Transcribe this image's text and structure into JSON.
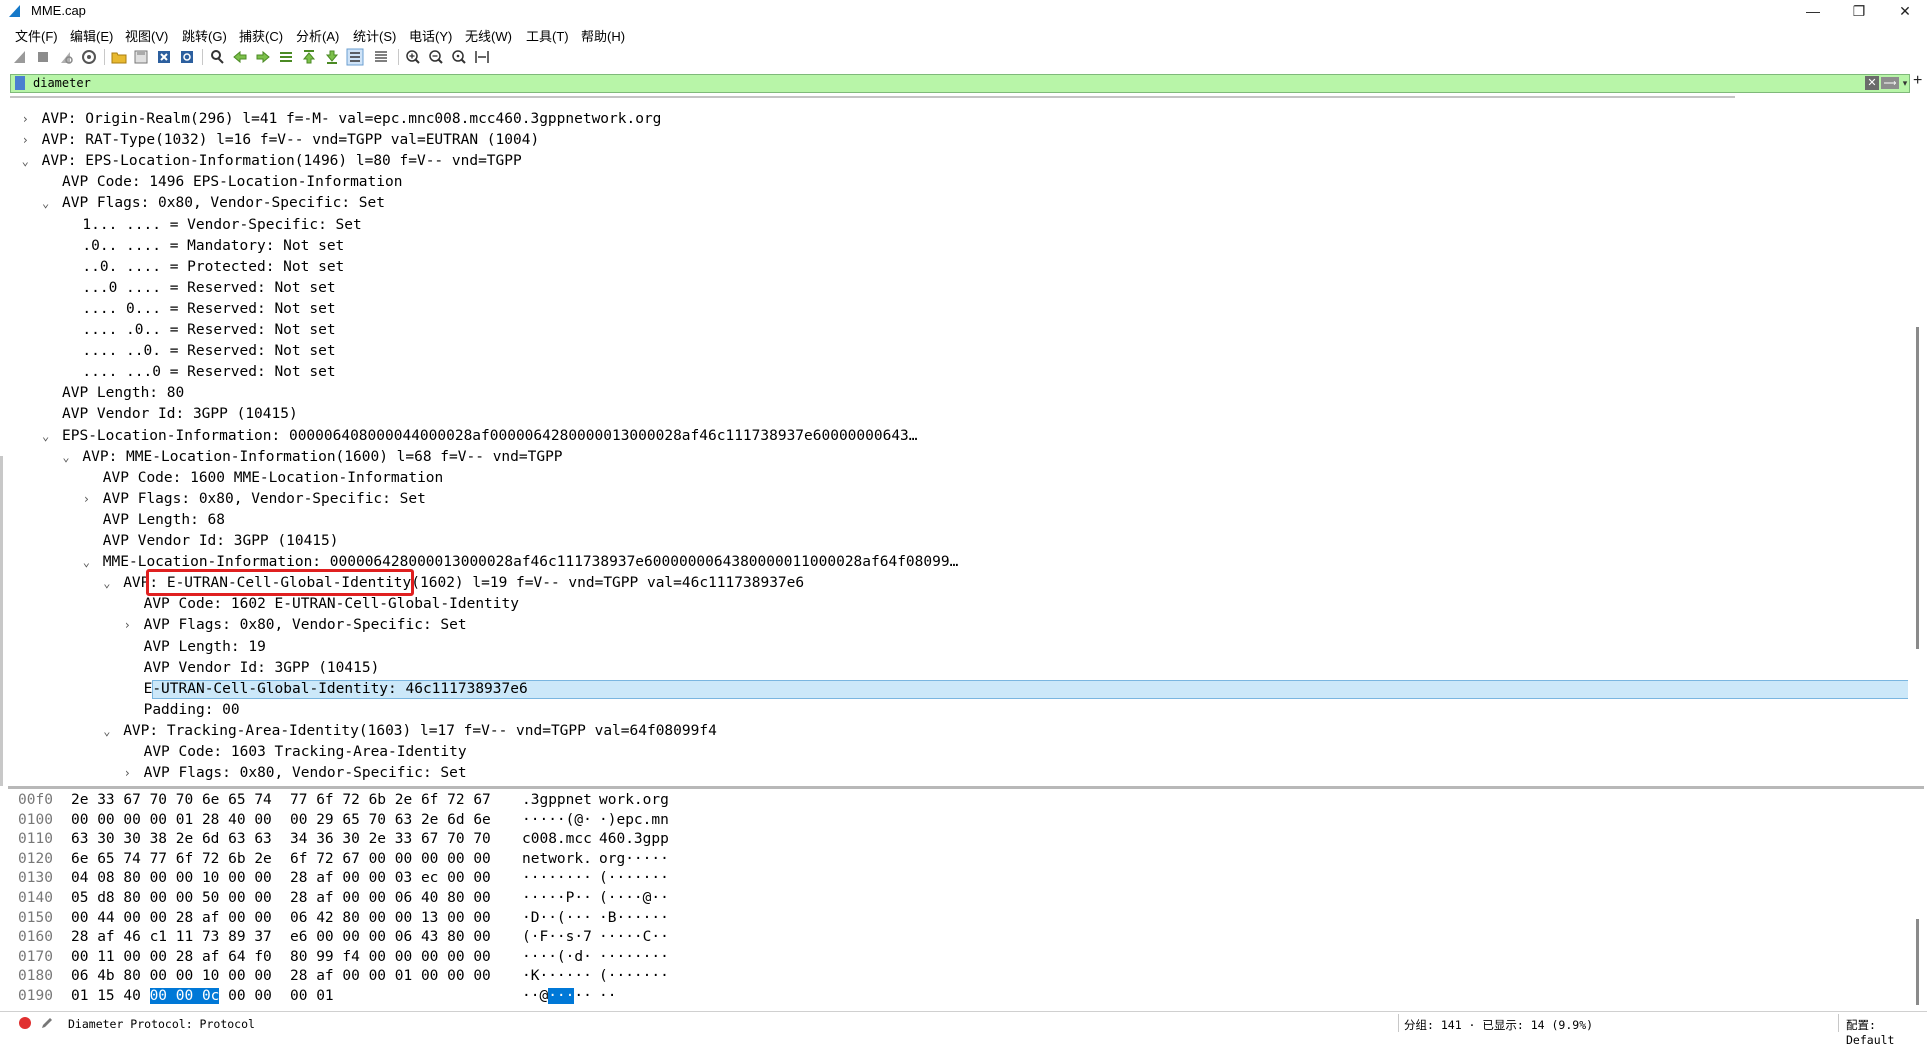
{
  "window": {
    "title": "MME.cap",
    "minimize": "—",
    "maximize": "❐",
    "close": "✕"
  },
  "menu": [
    "文件(F)",
    "编辑(E)",
    "视图(V)",
    "跳转(G)",
    "捕获(C)",
    "分析(A)",
    "统计(S)",
    "电话(Y)",
    "无线(W)",
    "工具(T)",
    "帮助(H)"
  ],
  "toolbar": {
    "icons": [
      "start-capture-icon",
      "stop-capture-icon",
      "restart-capture-icon",
      "capture-options-icon",
      "open-file-icon",
      "save-file-icon",
      "close-file-icon",
      "reload-file-icon",
      "find-packet-icon",
      "go-back-icon",
      "go-forward-icon",
      "go-to-packet-icon",
      "first-packet-icon",
      "last-packet-icon",
      "autoscroll-icon",
      "colorize-icon",
      "zoom-in-icon",
      "zoom-out-icon",
      "normal-size-icon",
      "resize-columns-icon"
    ]
  },
  "filter": {
    "value": "diameter",
    "clear_glyph": "✕",
    "apply_glyph": "⟶",
    "dropdown_glyph": "▾",
    "add_glyph": "+"
  },
  "detail": {
    "rows": [
      {
        "arrow": "›",
        "text": "AVP: Origin-Realm(296) l=41 f=-M- val=epc.mnc008.mcc460.3gppnetwork.org"
      },
      {
        "arrow": "›",
        "text": "AVP: RAT-Type(1032) l=16 f=V-- vnd=TGPP val=EUTRAN (1004)"
      },
      {
        "arrow": "⌄",
        "text": "AVP: EPS-Location-Information(1496) l=80 f=V-- vnd=TGPP"
      },
      {
        "arrow": "",
        "text": "AVP Code: 1496 EPS-Location-Information"
      },
      {
        "arrow": "⌄",
        "text": "AVP Flags: 0x80, Vendor-Specific: Set"
      },
      {
        "arrow": "",
        "text": "1... .... = Vendor-Specific: Set"
      },
      {
        "arrow": "",
        "text": ".0.. .... = Mandatory: Not set"
      },
      {
        "arrow": "",
        "text": "..0. .... = Protected: Not set"
      },
      {
        "arrow": "",
        "text": "...0 .... = Reserved: Not set"
      },
      {
        "arrow": "",
        "text": ".... 0... = Reserved: Not set"
      },
      {
        "arrow": "",
        "text": ".... .0.. = Reserved: Not set"
      },
      {
        "arrow": "",
        "text": ".... ..0. = Reserved: Not set"
      },
      {
        "arrow": "",
        "text": ".... ...0 = Reserved: Not set"
      },
      {
        "arrow": "",
        "text": "AVP Length: 80"
      },
      {
        "arrow": "",
        "text": "AVP Vendor Id: 3GPP (10415)"
      },
      {
        "arrow": "⌄",
        "text": "EPS-Location-Information: 000006408000044000028af0000064280000013000028af46c111738937e60000000643…"
      },
      {
        "arrow": "⌄",
        "text": "AVP: MME-Location-Information(1600) l=68 f=V-- vnd=TGPP"
      },
      {
        "arrow": "",
        "text": "AVP Code: 1600 MME-Location-Information"
      },
      {
        "arrow": "›",
        "text": "AVP Flags: 0x80, Vendor-Specific: Set"
      },
      {
        "arrow": "",
        "text": "AVP Length: 68"
      },
      {
        "arrow": "",
        "text": "AVP Vendor Id: 3GPP (10415)"
      },
      {
        "arrow": "⌄",
        "text": "MME-Location-Information: 000006428000013000028af46c111738937e6000000064380000011000028af64f08099…"
      },
      {
        "arrow": "⌄",
        "text": "AVP: E-UTRAN-Cell-Global-Identity(1602) l=19 f=V-- vnd=TGPP val=46c111738937e6"
      },
      {
        "arrow": "",
        "text": "AVP Code: 1602 E-UTRAN-Cell-Global-Identity"
      },
      {
        "arrow": "›",
        "text": "AVP Flags: 0x80, Vendor-Specific: Set"
      },
      {
        "arrow": "",
        "text": "AVP Length: 19"
      },
      {
        "arrow": "",
        "text": "AVP Vendor Id: 3GPP (10415)"
      },
      {
        "arrow": "",
        "text": "E-UTRAN-Cell-Global-Identity: 46c111738937e6"
      },
      {
        "arrow": "",
        "text": "Padding: 00"
      },
      {
        "arrow": "⌄",
        "text": "AVP: Tracking-Area-Identity(1603) l=17 f=V-- vnd=TGPP val=64f08099f4"
      },
      {
        "arrow": "",
        "text": "AVP Code: 1603 Tracking-Area-Identity"
      },
      {
        "arrow": "›",
        "text": "AVP Flags: 0x80, Vendor-Specific: Set"
      }
    ]
  },
  "bytes": {
    "rows": [
      {
        "off": "00f0",
        "h1": "2e 33 67 70 70 6e 65 74",
        "h2": "77 6f 72 6b 2e 6f 72 67",
        "a1": ".3gppnet",
        "a2": "work.org"
      },
      {
        "off": "0100",
        "h1": "00 00 00 00 01 28 40 00",
        "h2": "00 29 65 70 63 2e 6d 6e",
        "a1": "·····(@·",
        "a2": "·)epc.mn"
      },
      {
        "off": "0110",
        "h1": "63 30 30 38 2e 6d 63 63",
        "h2": "34 36 30 2e 33 67 70 70",
        "a1": "c008.mcc",
        "a2": "460.3gpp"
      },
      {
        "off": "0120",
        "h1": "6e 65 74 77 6f 72 6b 2e",
        "h2": "6f 72 67 00 00 00 00 00",
        "a1": "network.",
        "a2": "org·····"
      },
      {
        "off": "0130",
        "h1": "04 08 80 00 00 10 00 00",
        "h2": "28 af 00 00 03 ec 00 00",
        "a1": "········",
        "a2": "(·······"
      },
      {
        "off": "0140",
        "h1": "05 d8 80 00 00 50 00 00",
        "h2": "28 af 00 00 06 40 80 00",
        "a1": "·····P··",
        "a2": "(····@··"
      },
      {
        "off": "0150",
        "h1": "00 44 00 00 28 af 00 00",
        "h2": "06 42 80 00 00 13 00 00",
        "a1": "·D··(···",
        "a2": "·B······"
      },
      {
        "off": "0160",
        "h1": "28 af 46 c1 11 73 89 37",
        "h2": "e6 00 00 00 06 43 80 00",
        "a1": "(·F··s·7",
        "a2": "·····C··"
      },
      {
        "off": "0170",
        "h1": "00 11 00 00 28 af 64 f0",
        "h2": "80 99 f4 00 00 00 00 00",
        "a1": "····(·d·",
        "a2": "········"
      },
      {
        "off": "0180",
        "h1": "06 4b 80 00 00 10 00 00",
        "h2": "28 af 00 00 01 00 00 00",
        "a1": "·K······",
        "a2": "(·······"
      },
      {
        "off": "0190",
        "h1a": "01 15 40 ",
        "h1b": "00 00 0c",
        "h1c": " 00 00",
        "h2": "00 01",
        "a1a": "··@",
        "a1b": "···",
        "a1c": "··",
        "a2": "··"
      }
    ]
  },
  "status": {
    "left": "Diameter Protocol: Protocol",
    "middle": "分组: 141 · 已显示: 14 (9.9%)",
    "right": "配置: Default"
  }
}
